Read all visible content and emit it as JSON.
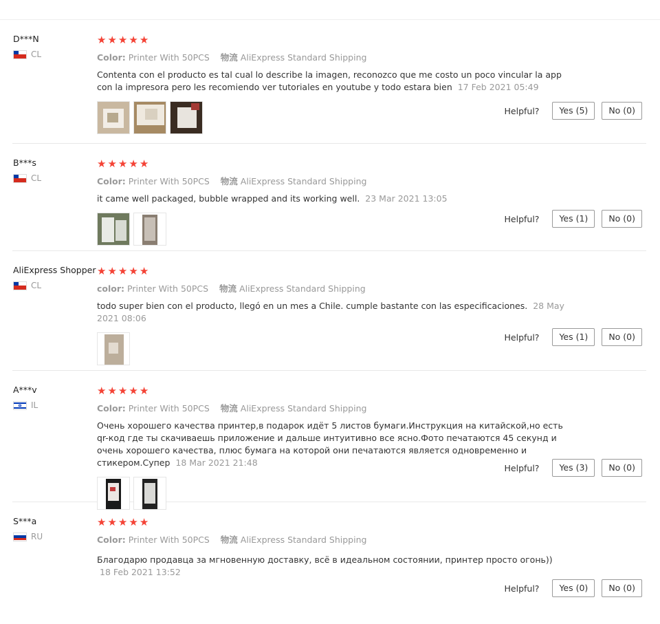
{
  "labels": {
    "helpful": "Helpful?",
    "shipping_key": "物流",
    "star": "★"
  },
  "reviews": [
    {
      "user": "D***N",
      "country": "CL",
      "rating": 5,
      "color_key": "Color:",
      "color_value": "Printer With 50PCS",
      "shipping": "AliExpress Standard Shipping",
      "text": "Contenta con el producto es tal cual lo describe la imagen, reconozco que me costo un poco vincular la app con la impresora pero les recomiendo ver tutoriales en youtube y todo estara bien",
      "time": "17 Feb 2021 05:49",
      "yes": "Yes (5)",
      "no": "No (0)"
    },
    {
      "user": "B***s",
      "country": "CL",
      "rating": 5,
      "color_key": "Color:",
      "color_value": "Printer With 50PCS",
      "shipping": "AliExpress Standard Shipping",
      "text": "it came well packaged, bubble wrapped and its working well.",
      "time": "23 Mar 2021 13:05",
      "yes": "Yes (1)",
      "no": "No (0)"
    },
    {
      "user": "AliExpress Shopper",
      "country": "CL",
      "rating": 5,
      "color_key": "color:",
      "color_value": "Printer With 50PCS",
      "shipping": "AliExpress Standard Shipping",
      "text": "todo super bien con el producto, llegó en un mes a Chile. cumple bastante con las especificaciones.",
      "time": "28 May 2021 08:06",
      "yes": "Yes (1)",
      "no": "No (0)"
    },
    {
      "user": "A***v",
      "country": "IL",
      "rating": 5,
      "color_key": "Color:",
      "color_value": "Printer With 50PCS",
      "shipping": "AliExpress Standard Shipping",
      "text": "Очень хорошего качества принтер,в подарок идёт 5 листов бумаги.Инструкция на китайской,но есть qr-код где ты скачиваешь приложение и дальше интуитивно все ясно.Фото печатаются 45 секунд и очень хорошего качества, плюс бумага на которой они печатаются является одновременно и стикером.Супер",
      "time": "18 Mar 2021 21:48",
      "yes": "Yes (3)",
      "no": "No (0)"
    },
    {
      "user": "S***a",
      "country": "RU",
      "rating": 5,
      "color_key": "Color:",
      "color_value": "Printer With 50PCS",
      "shipping": "AliExpress Standard Shipping",
      "text": "Благодарю продавца за мгновенную доставку, всё в идеальном состоянии, принтер просто огонь))",
      "time": "18 Feb 2021 13:52",
      "yes": "Yes (0)",
      "no": "No (0)"
    }
  ]
}
